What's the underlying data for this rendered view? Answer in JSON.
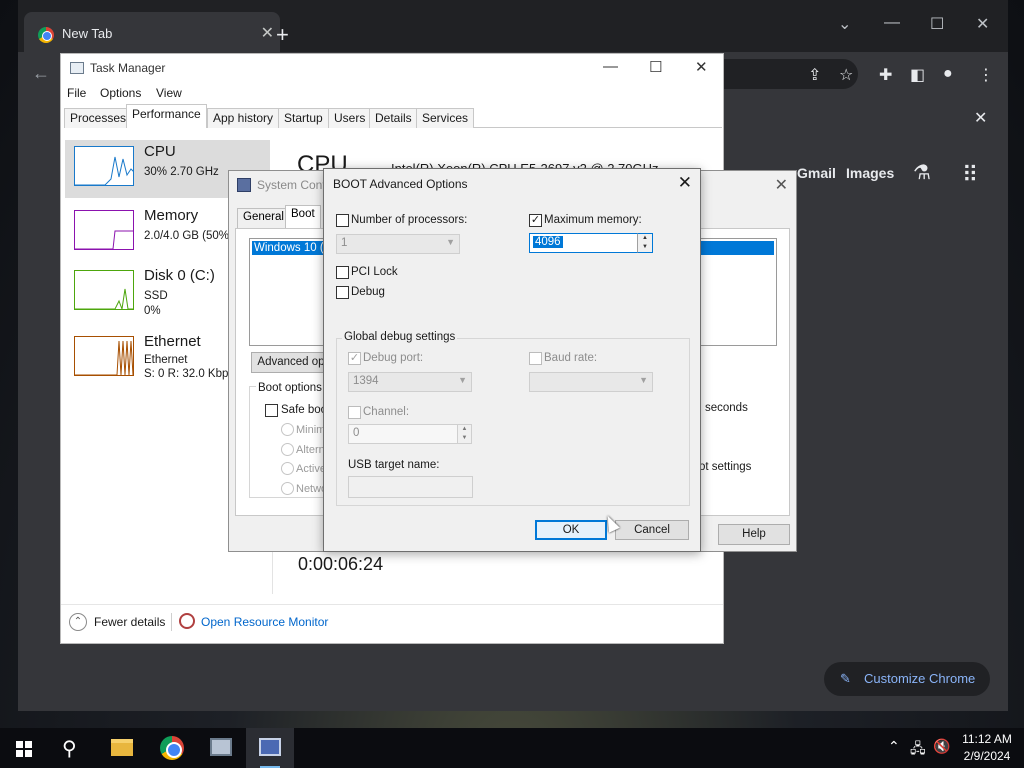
{
  "chrome": {
    "tab_title": "New Tab",
    "new_tab_symbol": "+",
    "links": {
      "gmail": "Gmail",
      "images": "Images"
    },
    "customize_label": "Customize Chrome",
    "icons": [
      "back-arrow",
      "share-icon",
      "star-icon",
      "extensions-icon",
      "sidepanel-icon",
      "profile-icon",
      "menu-icon",
      "labs-icon",
      "apps-icon"
    ]
  },
  "task_manager": {
    "title": "Task Manager",
    "menu": [
      "File",
      "Options",
      "View"
    ],
    "tabs": [
      "Processes",
      "Performance",
      "App history",
      "Startup",
      "Users",
      "Details",
      "Services"
    ],
    "active_tab": "Performance",
    "perf_items": [
      {
        "name": "CPU",
        "sub1": "30% 2.70 GHz",
        "sub2": "",
        "sub3": "",
        "color": "#1979ca"
      },
      {
        "name": "Memory",
        "sub1": "2.0/4.0 GB (50%",
        "sub2": "",
        "sub3": "",
        "color": "#8b12ae"
      },
      {
        "name": "Disk 0 (C:)",
        "sub1": "SSD",
        "sub2": "0%",
        "sub3": "",
        "color": "#4da60c"
      },
      {
        "name": "Ethernet",
        "sub1": "Ethernet",
        "sub2": "S: 0 R: 32.0 Kbp",
        "sub3": "",
        "color": "#a74f01"
      }
    ],
    "cpu_heading": "CPU",
    "cpu_model": "Intel(R) Xeon(R) CPU E5-2697 v2 @ 2.70GHz",
    "uptime": "0:00:06:24",
    "footer": {
      "fewer_details": "Fewer details",
      "open_resource_monitor": "Open Resource Monitor"
    }
  },
  "system_config": {
    "title": "System Conf",
    "tabs": [
      "General",
      "Boot"
    ],
    "active_tab": "Boot",
    "os_entry": "Windows 10 (C",
    "advanced_button": "Advanced op",
    "boot_options_label": "Boot options",
    "safe_boot_label": "Safe boot",
    "radio_options": [
      "Minima",
      "Altern",
      "Active",
      "Netwo"
    ],
    "timeout_unit": "seconds",
    "make_permanent_fragment": "ot settings",
    "help_button": "Help"
  },
  "boot_advanced": {
    "title": "BOOT Advanced Options",
    "num_processors": {
      "label": "Number of processors:",
      "checked": false,
      "value": "1"
    },
    "max_memory": {
      "label": "Maximum memory:",
      "checked": true,
      "value": "4096"
    },
    "pci_lock": {
      "label": "PCI Lock",
      "checked": false
    },
    "debug": {
      "label": "Debug",
      "checked": false
    },
    "global_debug_label": "Global debug settings",
    "debug_port": {
      "label": "Debug port:",
      "checked": true,
      "value": "1394"
    },
    "baud_rate": {
      "label": "Baud rate:",
      "checked": false,
      "value": ""
    },
    "channel": {
      "label": "Channel:",
      "checked": false,
      "value": "0"
    },
    "usb_target": {
      "label": "USB target name:",
      "value": ""
    },
    "ok_label": "OK",
    "cancel_label": "Cancel"
  },
  "taskbar": {
    "apps": [
      "start-button",
      "search-button",
      "file-explorer",
      "chrome",
      "task-manager",
      "system-configuration"
    ],
    "clock": {
      "time": "11:12 AM",
      "date": "2/9/2024"
    }
  }
}
